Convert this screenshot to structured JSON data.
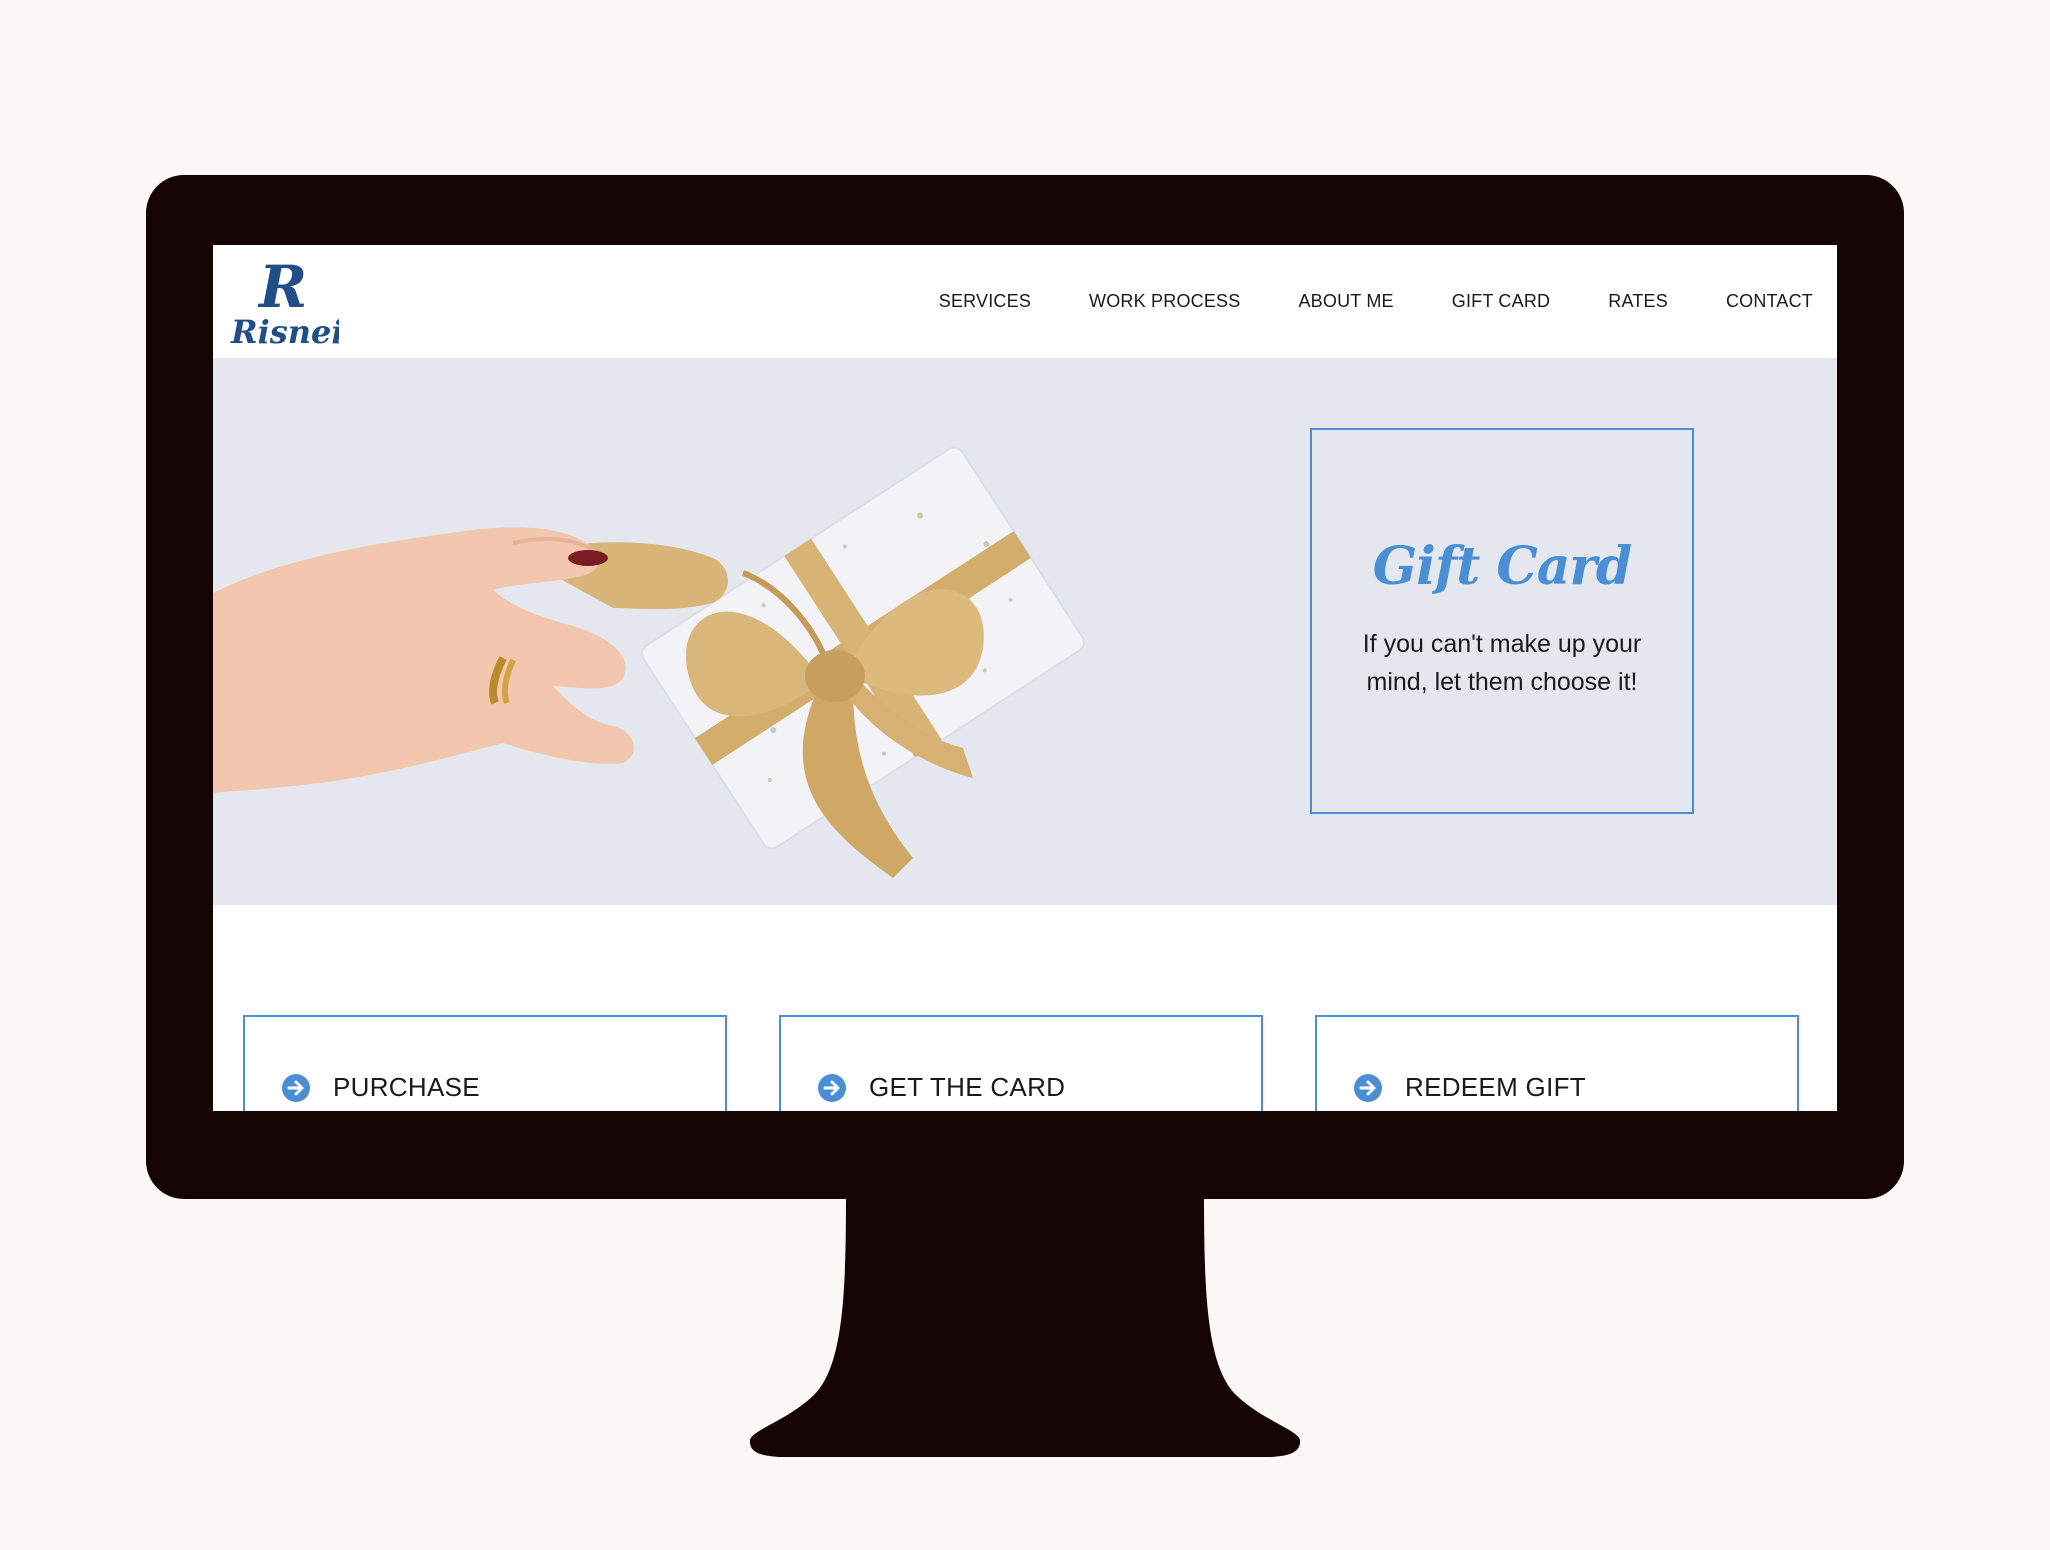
{
  "logo": {
    "letter": "R",
    "wordmark": "Risnei"
  },
  "nav": {
    "items": [
      {
        "label": "SERVICES"
      },
      {
        "label": "WORK PROCESS"
      },
      {
        "label": "ABOUT ME"
      },
      {
        "label": "GIFT CARD"
      },
      {
        "label": "RATES"
      },
      {
        "label": "CONTACT"
      }
    ]
  },
  "hero": {
    "title": "Gift Card",
    "subtitle": "If you can't make up your mind, let them choose it!"
  },
  "cards": [
    {
      "label": "PURCHASE",
      "icon": "arrow-right-circle-icon"
    },
    {
      "label": "GET THE CARD",
      "icon": "arrow-right-circle-icon"
    },
    {
      "label": "REDEEM GIFT",
      "icon": "arrow-right-circle-icon"
    }
  ],
  "colors": {
    "accent": "#4a8fd4",
    "logo": "#1f4f86",
    "bezel": "#160303",
    "hero_bg": "#e4e8ee",
    "page_bg": "#fcf8f7"
  }
}
